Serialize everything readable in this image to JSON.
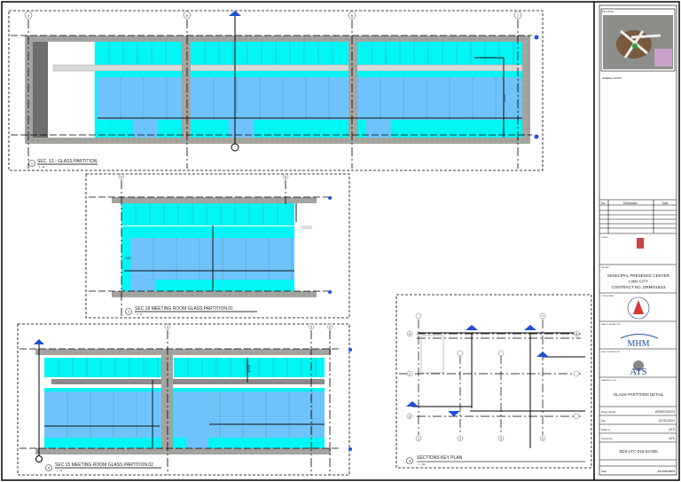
{
  "colors": {
    "glass_cyan": "#00f5f5",
    "glass_blue": "#6fc3fb",
    "concrete": "#9a9a96",
    "section_marker": "#1f4fd8"
  },
  "sections": [
    {
      "number": "1",
      "title": "SEC. 13 - GLASS PARTITION",
      "scale": "1 : 20",
      "grids": [
        "4",
        "5",
        "6",
        "7"
      ],
      "dimension": "1000"
    },
    {
      "number": "2",
      "title": "SEC.18 MEETING ROOM GLASS PARTITION.01",
      "scale": "1 : 20",
      "grids": [
        "4",
        "5"
      ],
      "dimension": "240"
    },
    {
      "number": "3",
      "title": "SEC.15 MEETING ROOM GLASS PARTITION.02",
      "scale": "1 : 20",
      "grids": [
        "4",
        "5",
        "6"
      ],
      "dimension": "1018"
    },
    {
      "number": "4",
      "title": "SECTIONS KEY PLAN",
      "scale": "1 : 100",
      "grids": [
        "A",
        "B",
        "C",
        "D",
        "3",
        "4",
        "5",
        "6",
        "7"
      ]
    }
  ],
  "title_block": {
    "key_plan_label": "KEY PLAN",
    "general_notes_label": "GENERAL NOTES",
    "revision_headers": [
      "No.",
      "Description",
      "Date"
    ],
    "client_label": "CLIENT",
    "project_label": "PROJECT",
    "project_lines": [
      "MUNICIPAL PRESENCE CENTER",
      "LIWA CITY",
      "CONTRACT NO. DRM/015/23"
    ],
    "consultant_label": "CONSULTANT",
    "main_contractor_label": "MAIN CONTRACTOR",
    "main_contractor_logo": "MHM",
    "subcontractor_label": "SUB CONTRACTOR",
    "subcontractor_logo": "ATS",
    "drawing_title_label": "DRAWING TITLE",
    "drawing_title": "GLASS PARTITION DETAIL",
    "rows": [
      {
        "label": "Project number",
        "value": "DRM/015/023"
      },
      {
        "label": "Date",
        "value": "24-03-2024"
      },
      {
        "label": "Drawn by",
        "value": "ATS"
      },
      {
        "label": "Checked by",
        "value": "ATS"
      }
    ],
    "drawing_number": "SDS-LTC-015-23-005",
    "scale_label": "Scale",
    "scale_value": "As indicated"
  }
}
